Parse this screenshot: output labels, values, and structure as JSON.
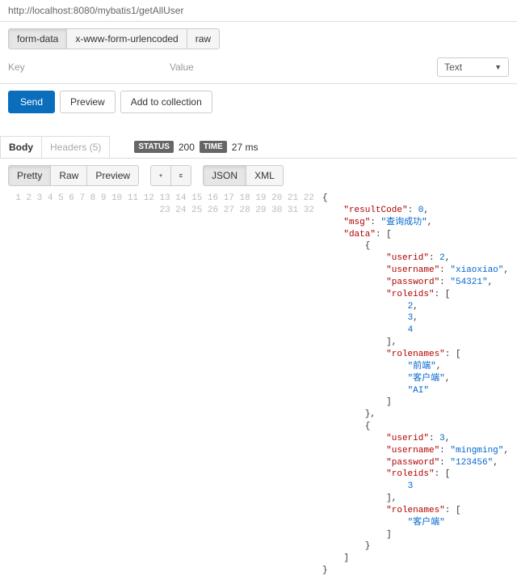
{
  "url": "http://localhost:8080/mybatis1/getAllUser",
  "body_type_tabs": {
    "form_data": "form-data",
    "urlencoded": "x-www-form-urlencoded",
    "raw": "raw"
  },
  "kv_header": {
    "key": "Key",
    "value": "Value"
  },
  "type_select": {
    "selected": "Text"
  },
  "actions": {
    "send": "Send",
    "preview": "Preview",
    "add": "Add to collection"
  },
  "response_tabs": {
    "body": "Body",
    "headers": "Headers (5)"
  },
  "status": {
    "label": "STATUS",
    "code": "200",
    "time_label": "TIME",
    "time": "27 ms"
  },
  "view_tabs": {
    "pretty": "Pretty",
    "raw": "Raw",
    "preview": "Preview"
  },
  "format_tabs": {
    "json": "JSON",
    "xml": "XML"
  },
  "gutter": "1\n2\n3\n4\n5\n6\n7\n8\n9\n10\n11\n12\n13\n14\n15\n16\n17\n18\n19\n20\n21\n22\n23\n24\n25\n26\n27\n28\n29\n30\n31\n32",
  "json_body": {
    "resultCode": 0,
    "msg": "查询成功",
    "data": [
      {
        "userid": 2,
        "username": "xiaoxiao",
        "password": "54321",
        "roleids": [
          2,
          3,
          4
        ],
        "rolenames": [
          "前端",
          "客户端",
          "AI"
        ]
      },
      {
        "userid": 3,
        "username": "mingming",
        "password": "123456",
        "roleids": [
          3
        ],
        "rolenames": [
          "客户端"
        ]
      }
    ]
  },
  "code": {
    "open": "{",
    "rc_k": "\"resultCode\"",
    "rc_v": "0",
    "msg_k": "\"msg\"",
    "msg_v": "\"查询成功\"",
    "data_k": "\"data\"",
    "uid_k": "\"userid\"",
    "uid1": "2",
    "uid2": "3",
    "un_k": "\"username\"",
    "un1": "\"xiaoxiao\"",
    "un2": "\"mingming\"",
    "pw_k": "\"password\"",
    "pw1": "\"54321\"",
    "pw2": "\"123456\"",
    "rid_k": "\"roleids\"",
    "r1a": "2",
    "r1b": "3",
    "r1c": "4",
    "r2a": "3",
    "rn_k": "\"rolenames\"",
    "rn1a": "\"前端\"",
    "rn1b": "\"客户端\"",
    "rn1c": "\"AI\"",
    "rn2a": "\"客户端\"",
    "close": "}"
  }
}
